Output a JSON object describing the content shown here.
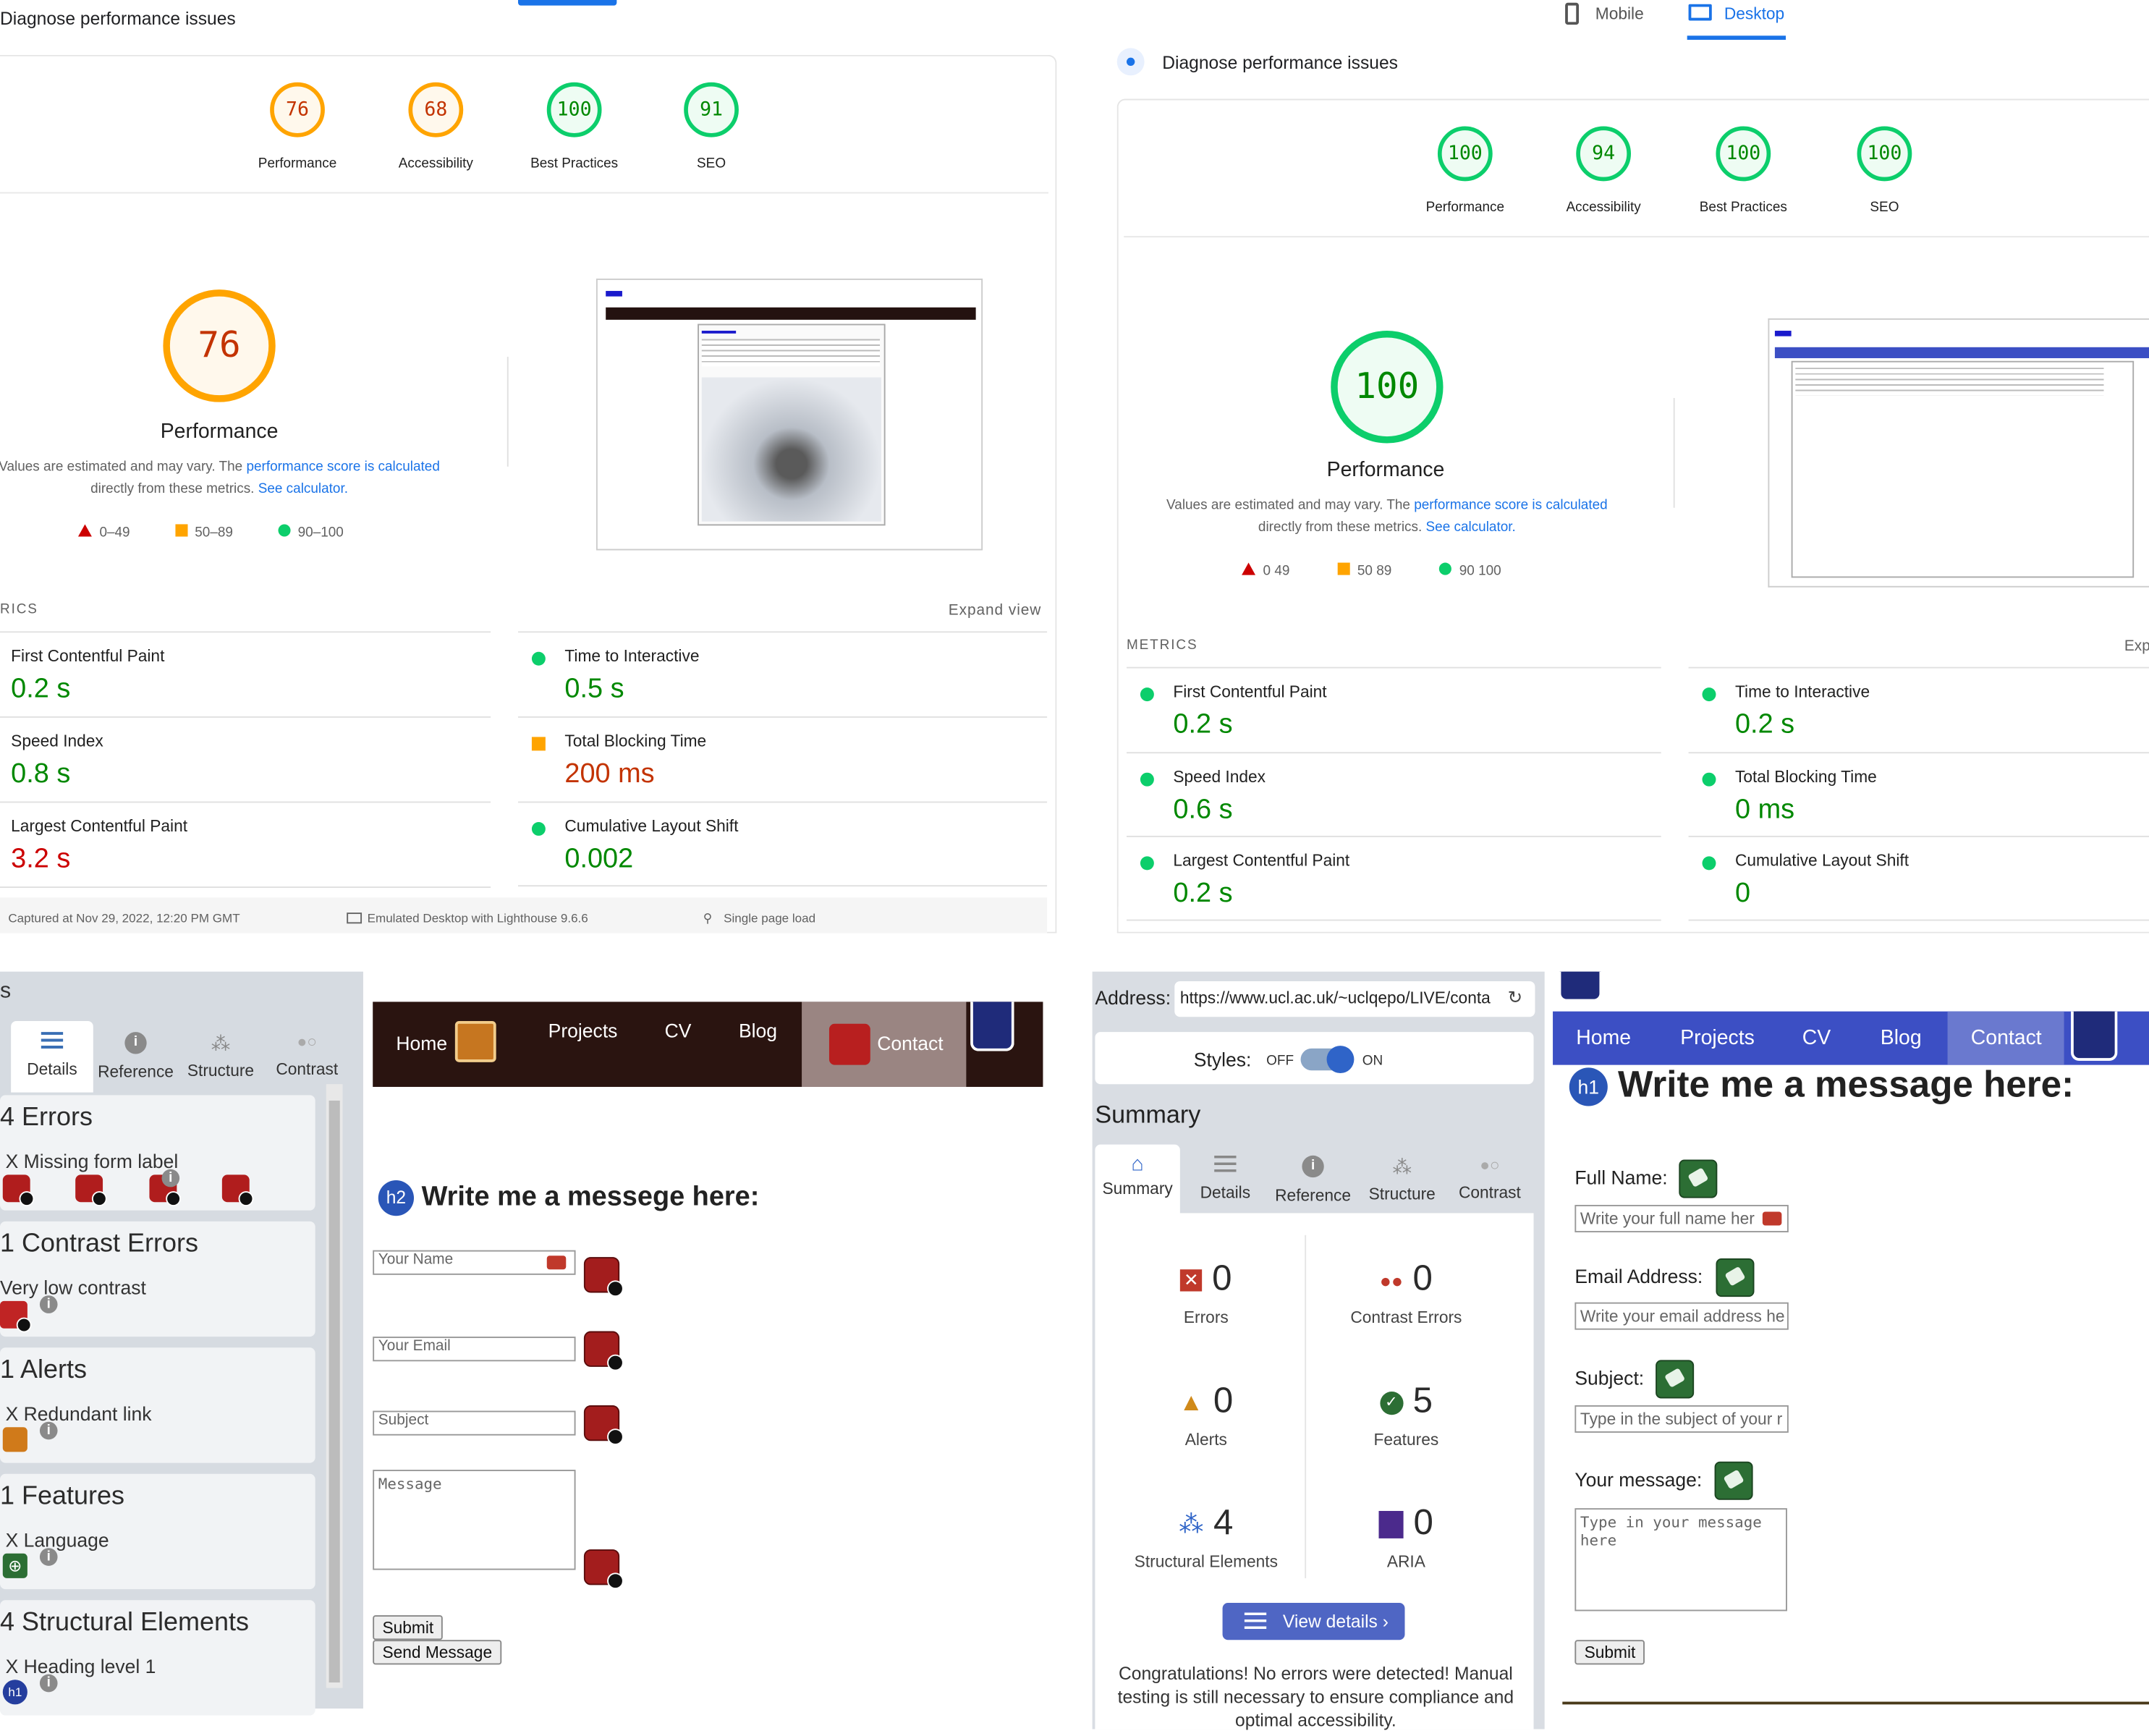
{
  "left_report": {
    "title": "Diagnose performance issues",
    "gauges": [
      {
        "label": "Performance",
        "score": "76"
      },
      {
        "label": "Accessibility",
        "score": "68"
      },
      {
        "label": "Best Practices",
        "score": "100"
      },
      {
        "label": "SEO",
        "score": "91"
      }
    ],
    "main_score": "76",
    "main_label": "Performance",
    "note_prefix": "Values are estimated and may vary. The ",
    "note_link": "performance score is calculated",
    "note_mid": "directly from these metrics. ",
    "note_link2": "See calculator.",
    "legend": [
      "0–49",
      "50–89",
      "90–100"
    ],
    "metrics_header": "RICS",
    "expand": "Expand view",
    "metrics": [
      {
        "name": "First Contentful Paint",
        "value": "0.2 s"
      },
      {
        "name": "Time to Interactive",
        "value": "0.5 s"
      },
      {
        "name": "Speed Index",
        "value": "0.8 s"
      },
      {
        "name": "Total Blocking Time",
        "value": "200 ms"
      },
      {
        "name": "Largest Contentful Paint",
        "value": "3.2 s"
      },
      {
        "name": "Cumulative Layout Shift",
        "value": "0.002"
      }
    ],
    "footer": [
      "Captured at Nov 29, 2022, 12:20 PM GMT",
      "Emulated Desktop with Lighthouse 9.6.6",
      "Single page load"
    ]
  },
  "right_report": {
    "tabs": [
      "Mobile",
      "Desktop"
    ],
    "title": "Diagnose performance issues",
    "gauges": [
      {
        "label": "Performance",
        "score": "100"
      },
      {
        "label": "Accessibility",
        "score": "94"
      },
      {
        "label": "Best Practices",
        "score": "100"
      },
      {
        "label": "SEO",
        "score": "100"
      }
    ],
    "main_score": "100",
    "main_label": "Performance",
    "note_prefix": "Values are estimated and may vary. The ",
    "note_link": "performance score is calculated",
    "note_mid": "directly from these metrics. ",
    "note_link2": "See calculator.",
    "legend": [
      "0 49",
      "50 89",
      "90 100"
    ],
    "metrics_header": "METRICS",
    "expand": "Exp",
    "metrics": [
      {
        "name": "First Contentful Paint",
        "value": "0.2 s"
      },
      {
        "name": "Time to Interactive",
        "value": "0.2 s"
      },
      {
        "name": "Speed Index",
        "value": "0.6 s"
      },
      {
        "name": "Total Blocking Time",
        "value": "0 ms"
      },
      {
        "name": "Largest Contentful Paint",
        "value": "0.2 s"
      },
      {
        "name": "Cumulative Layout Shift",
        "value": "0"
      }
    ]
  },
  "wave_left": {
    "corner": "s",
    "tabs": [
      "Details",
      "Reference",
      "Structure",
      "Contrast"
    ],
    "cards": [
      {
        "title": "4 Errors",
        "sub": "X Missing form label"
      },
      {
        "title": "1 Contrast Errors",
        "sub": "Very low contrast"
      },
      {
        "title": "1 Alerts",
        "sub": "X Redundant link"
      },
      {
        "title": "1 Features",
        "sub": "X Language"
      },
      {
        "title": "4 Structural Elements",
        "sub": "X Heading level 1"
      }
    ],
    "nav": [
      "Home",
      "Projects",
      "CV",
      "Blog",
      "Contact"
    ],
    "heading": "Write me a messege here:",
    "placeholders": [
      "Your Name",
      "Your Email",
      "Subject",
      "Message"
    ],
    "buttons": [
      "Submit",
      "Send Message"
    ]
  },
  "wave_right": {
    "address_label": "Address:",
    "address": "https://www.ucl.ac.uk/~uclqepo/LIVE/conta",
    "styles_label": "Styles:",
    "off": "OFF",
    "on": "ON",
    "summary": "Summary",
    "tabs": [
      "Summary",
      "Details",
      "Reference",
      "Structure",
      "Contrast"
    ],
    "stats": [
      {
        "n": "0",
        "l": "Errors"
      },
      {
        "n": "0",
        "l": "Contrast Errors"
      },
      {
        "n": "0",
        "l": "Alerts"
      },
      {
        "n": "5",
        "l": "Features"
      },
      {
        "n": "4",
        "l": "Structural Elements"
      },
      {
        "n": "0",
        "l": "ARIA"
      }
    ],
    "view_details": "View details ›",
    "congrats": "Congratulations! No errors were detected! Manual testing is still necessary to ensure compliance and optimal accessibility.",
    "nav": [
      "Home",
      "Projects",
      "CV",
      "Blog",
      "Contact"
    ],
    "heading": "Write me a message here:",
    "labels": [
      "Full Name:",
      "Email Address:",
      "Subject:",
      "Your message:"
    ],
    "placeholders": [
      "Write your full name her",
      "Write your email address he",
      "Type in the subject of your r",
      "Type in your message here"
    ],
    "submit": "Submit"
  },
  "colors": {
    "green": "#0cce6b",
    "orange": "#ffa400",
    "red": "#cc0000",
    "wave_blue": "#3c4fc4"
  }
}
